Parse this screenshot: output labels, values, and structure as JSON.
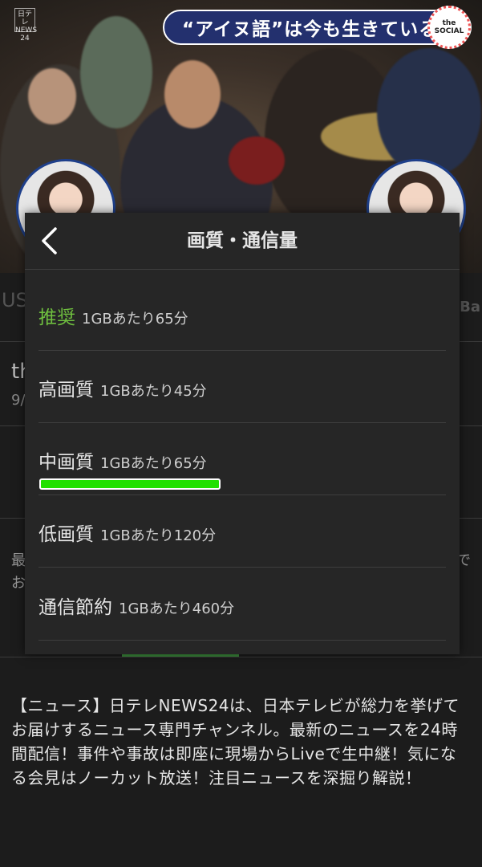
{
  "video": {
    "caption": "“アイヌ語”は今も生きている",
    "channel_logo": "日テレ NEWS 24",
    "social_logo": [
      "the",
      "SOCIAL"
    ]
  },
  "background": {
    "us": "US",
    "ba": "Ba",
    "th": "th",
    "date": "9/",
    "sai": "最",
    "de": "で",
    "o": "お"
  },
  "modal": {
    "title": "画質・通信量",
    "back_icon": "chevron-left-icon",
    "options": [
      {
        "name": "推奨",
        "desc": "1GBあたり65分",
        "recommended": true
      },
      {
        "name": "高画質",
        "desc": "1GBあたり45分"
      },
      {
        "name": "中画質",
        "desc": "1GBあたり65分",
        "selected": true
      },
      {
        "name": "低画質",
        "desc": "1GBあたり120分"
      },
      {
        "name": "通信節約",
        "desc": "1GBあたり460分"
      }
    ]
  },
  "description": "【ニュース】日テレNEWS24は、日本テレビが総力を挙げてお届けするニュース専門チャンネル。最新のニュースを24時間配信！事件や事故は即座に現場からLiveで生中継！気になる会見はノーカット放送！注目ニュースを深掘り解説！",
  "colors": {
    "recommended": "#6fbf3f",
    "selected_bar": "#22e000",
    "caption_bg": "#23306e"
  }
}
